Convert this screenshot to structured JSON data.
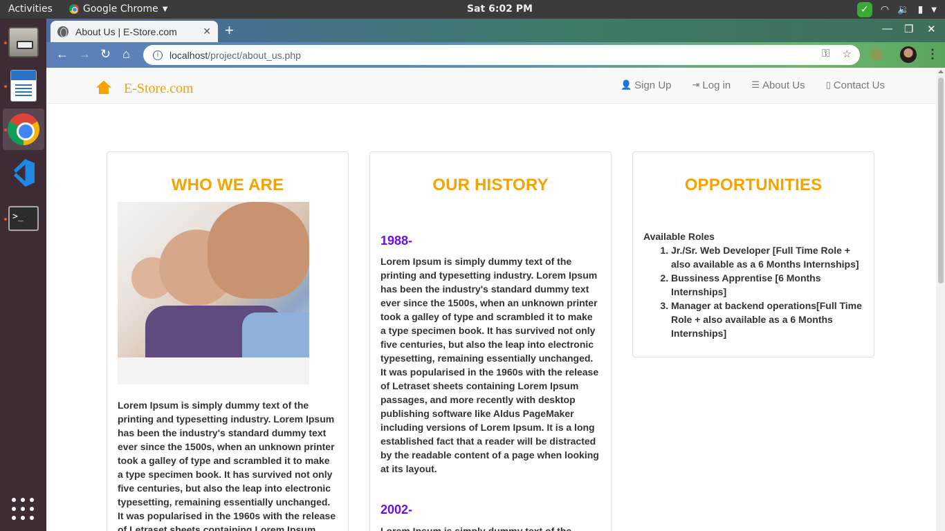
{
  "os": {
    "activities": "Activities",
    "app_name": "Google Chrome",
    "clock": "Sat  6:02 PM"
  },
  "browser": {
    "tab_title": "About Us | E-Store.com",
    "url_host": "localhost",
    "url_path": "/project/about_us.php"
  },
  "site": {
    "brand": "E-Store.com",
    "nav": [
      {
        "label": "Sign Up",
        "icon": "user-icon"
      },
      {
        "label": "Log in",
        "icon": "login-icon"
      },
      {
        "label": "About Us",
        "icon": "list-icon"
      },
      {
        "label": "Contact Us",
        "icon": "phone-icon"
      }
    ],
    "brand_color": "#f5a300",
    "year_color": "#6a0dee"
  },
  "who": {
    "title": "WHO WE ARE",
    "text": "Lorem Ipsum is simply dummy text of the printing and typesetting industry. Lorem Ipsum has been the industry's standard dummy text ever since the 1500s, when an unknown printer took a galley of type and scrambled it to make a type specimen book. It has survived not only five centuries, but also the leap into electronic typesetting, remaining essentially unchanged. It was popularised in the 1960s with the release of Letraset sheets containing Lorem Ipsum"
  },
  "history": {
    "title": "OUR HISTORY",
    "entries": [
      {
        "year": "1988-",
        "text": "Lorem Ipsum is simply dummy text of the printing and typesetting industry. Lorem Ipsum has been the industry's standard dummy text ever since the 1500s, when an unknown printer took a galley of type and scrambled it to make a type specimen book. It has survived not only five centuries, but also the leap into electronic typesetting, remaining essentially unchanged. It was popularised in the 1960s with the release of Letraset sheets containing Lorem Ipsum passages, and more recently with desktop publishing software like Aldus PageMaker including versions of Lorem Ipsum. It is a long established fact that a reader will be distracted by the readable content of a page when looking at its layout."
      },
      {
        "year": "2002-",
        "text": "Lorem Ipsum is simply dummy text of the"
      }
    ]
  },
  "opportunities": {
    "title": "OPPORTUNITIES",
    "intro": "Available Roles",
    "roles": [
      "Jr./Sr. Web Developer [Full Time Role + also available as a 6 Months Internships]",
      "Bussiness Apprentise [6 Months Internships]",
      "Manager at backend operations[Full Time Role + also available as a 6 Months Internships]"
    ]
  }
}
